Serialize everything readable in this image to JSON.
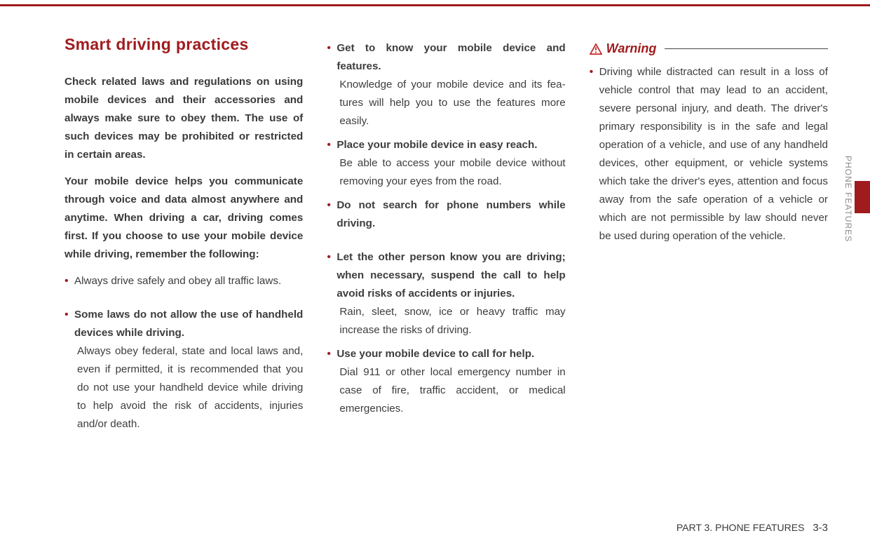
{
  "sideTab": {
    "label": "PHONE FEATURES"
  },
  "title": "Smart driving practices",
  "intro1": "Check related laws and regulations on using mobile devices and their accesso­ries and always make sure to obey them. The use of such devices may be prohibited or restricted in certain areas.",
  "intro2": "Your mobile device helps you communi­cate through voice and data almost any­where and anytime. When driving a car, driving comes first. If you choose to use your mobile device while driving, remem­ber the following:",
  "col1": {
    "b1": "Always drive safely and obey all traffic laws.",
    "b2_bold": "Some laws do not allow the use of hand­held devices while driving.",
    "b2_sub": "Always obey federal, state and local laws and, even if permitted, it is recommended that you do not use your handheld device while driving to help avoid the risk of acci­dents, injuries and/or death."
  },
  "col2": {
    "b1_bold": "Get to know your mobile device and features.",
    "b1_sub": "Knowledge of your mobile device and its fea­tures will help you to use the features more easily.",
    "b2_bold": "Place your mobile device in easy reach.",
    "b2_sub": "Be able to access your mobile device with­out removing your eyes from the road.",
    "b3_bold": "Do not search for phone numbers while driving.",
    "b4_bold": "Let the other person know you are driv­ing; when necessary, suspend the call to help avoid risks of accidents or injuries.",
    "b4_sub": "Rain, sleet, snow, ice or heavy traffic may increase the risks of driving.",
    "b5_bold": "Use your mobile device to call for help.",
    "b5_sub": "Dial 911 or other local emergency number in case of fire, traffic accident, or medical emergencies."
  },
  "warning": {
    "label": "Warning",
    "text": "Driving while distracted can result in a loss of vehicle control that may lead to an acci­dent, severe personal injury, and death. The driver's primary responsibility is in the safe and legal operation of a vehicle, and use of any handheld devices, other equip­ment, or vehicle systems which take the driver's eyes, attention and focus away from the safe operation of a vehicle or which are not permissible by law should never be used during operation of the vehicle."
  },
  "footer": {
    "part": "PART 3. PHONE FEATURES",
    "page": "3-3"
  }
}
